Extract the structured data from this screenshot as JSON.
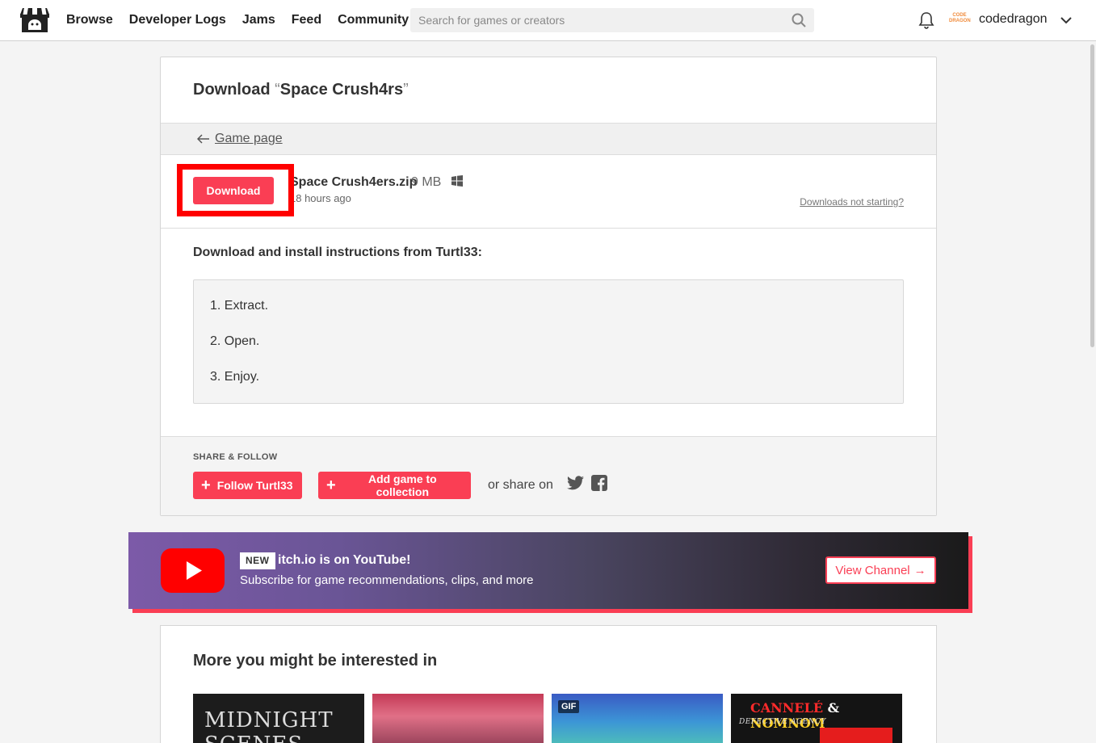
{
  "header": {
    "nav": [
      "Browse",
      "Developer Logs",
      "Jams",
      "Feed",
      "Community"
    ],
    "search_placeholder": "Search for games or creators",
    "avatar_text": "CODE DRAGON",
    "username": "codedragon"
  },
  "download_page": {
    "title_prefix": "Download",
    "open_quote": "“",
    "game_name": "Space Crush4rs",
    "close_quote": "”",
    "back_link": "Game page",
    "download_button": "Download",
    "file_name": "Space Crush4ers.zip",
    "file_size": "9 MB",
    "file_date": "18 hours ago",
    "downloads_not_starting": "Downloads not starting?",
    "instructions_title": "Download and install instructions from Turtl33:",
    "instructions": [
      "1. Extract.",
      "2. Open.",
      "3. Enjoy."
    ],
    "share_label": "SHARE & FOLLOW",
    "follow_button": "Follow Turtl33",
    "collection_button": "Add game to collection",
    "or_share_on": "or share on"
  },
  "youtube_banner": {
    "badge": "NEW",
    "title": "itch.io is on YouTube!",
    "subtitle": "Subscribe for game recommendations, clips, and more",
    "button": "View Channel",
    "button_arrow": "→"
  },
  "more": {
    "title": "More you might be interested in",
    "thumb1_text": "MIDNIGHT SCENES",
    "thumb3_badge": "GIF",
    "thumb4_title_a": "CANNELÉ",
    "thumb4_title_amp": "&",
    "thumb4_title_b": "NOMNOM",
    "thumb4_subtitle": "DEFECTIVE AGENCY"
  },
  "colors": {
    "accent": "#fa3e54",
    "highlight": "#ff0000",
    "youtube_red": "#ff0000"
  },
  "icons": [
    "itchio-logo-icon",
    "search-icon",
    "bell-icon",
    "chevron-down-icon",
    "arrow-left-icon",
    "windows-icon",
    "plus-icon",
    "twitter-icon",
    "facebook-icon",
    "youtube-play-icon"
  ]
}
